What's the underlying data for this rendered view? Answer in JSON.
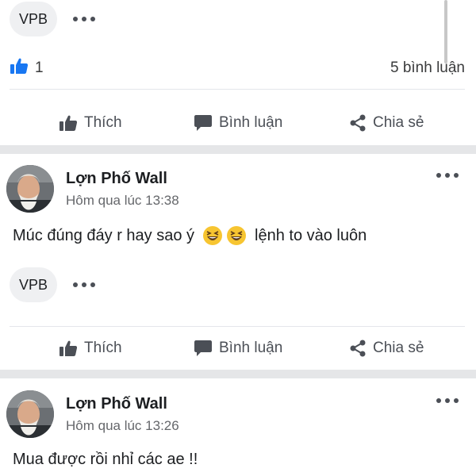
{
  "colors": {
    "accent": "#1877f2",
    "separator": "#e5e6e8",
    "chip_bg": "#eff0f2",
    "emoji": "#f7c531"
  },
  "top_post": {
    "tag": "VPB",
    "likes_count": "1",
    "comments_count": "5 bình luận"
  },
  "actions": {
    "like": "Thích",
    "comment": "Bình luận",
    "share": "Chia sẻ"
  },
  "posts": [
    {
      "author": "Lợn Phố Wall",
      "time": "Hôm qua lúc 13:38",
      "text_before": "Múc đúng đáy r hay sao ý",
      "emojis": [
        "grinning-squinting-face",
        "grinning-squinting-face"
      ],
      "text_after": "lệnh to vào luôn",
      "tag": "VPB"
    },
    {
      "author": "Lợn Phố Wall",
      "time": "Hôm qua lúc 13:26",
      "text": "Mua được rồi nhỉ các ae !!"
    }
  ]
}
